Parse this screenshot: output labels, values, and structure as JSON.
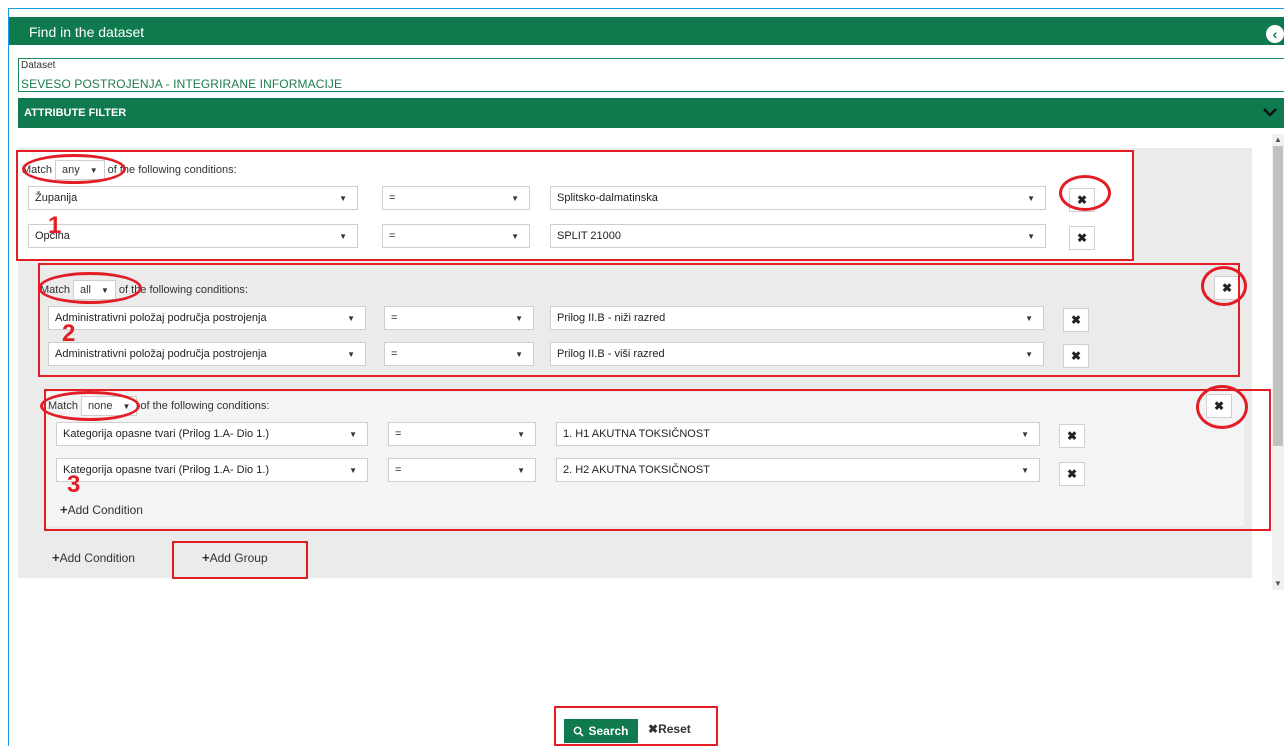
{
  "panel": {
    "title": "Find in the dataset"
  },
  "dataset": {
    "label": "Dataset",
    "value": "SEVESO POSTROJENJA - INTEGRIRANE INFORMACIJE"
  },
  "attribute_filter": {
    "title": "ATTRIBUTE FILTER"
  },
  "match_text": "of the following conditions:",
  "match_prefix": "Match",
  "groups": [
    {
      "match": "any",
      "number": "1",
      "conditions": [
        {
          "field": "Županija",
          "operator": "=",
          "value": "Splitsko-dalmatinska"
        },
        {
          "field": "Općina",
          "operator": "=",
          "value": "SPLIT 21000"
        }
      ]
    },
    {
      "match": "all",
      "number": "2",
      "conditions": [
        {
          "field": "Administrativni položaj područja postrojenja",
          "operator": "=",
          "value": "Prilog II.B - niži razred"
        },
        {
          "field": "Administrativni položaj područja postrojenja",
          "operator": "=",
          "value": "Prilog II.B - viši razred"
        }
      ]
    },
    {
      "match": "none",
      "number": "3",
      "conditions": [
        {
          "field": "Kategorija opasne tvari (Prilog 1.A- Dio 1.)",
          "operator": "=",
          "value": "1. H1 AKUTNA TOKSIČNOST"
        },
        {
          "field": "Kategorija opasne tvari (Prilog 1.A- Dio 1.)",
          "operator": "=",
          "value": "2. H2 AKUTNA TOKSIČNOST"
        }
      ]
    }
  ],
  "actions": {
    "add_condition": "Add Condition",
    "add_group": "Add Group",
    "search": "Search",
    "reset": "Reset"
  },
  "colors": {
    "header_green": "#0e7a4d",
    "annotation_red": "#e31d25"
  },
  "icons": {
    "collapse": "chevron-left-circle-icon",
    "expand": "chevron-down-icon",
    "remove": "close-icon",
    "search": "magnifier-icon"
  }
}
